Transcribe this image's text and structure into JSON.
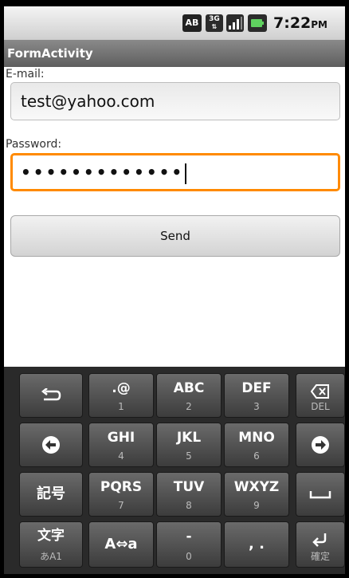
{
  "statusbar": {
    "ab_badge": "AB",
    "network_badge": "3G",
    "time": "7:22",
    "ampm": "PM"
  },
  "app": {
    "title": "FormActivity"
  },
  "form": {
    "email_label": "E-mail:",
    "email_value": "test@yahoo.com",
    "password_label": "Password:",
    "password_dots": "•••••••••••••",
    "send_label": "Send"
  },
  "keyboard": {
    "keys": {
      "undo": {
        "icon": "undo-arrow-icon"
      },
      "punct": {
        "main": ".@",
        "sub": "1"
      },
      "abc": {
        "main": "ABC",
        "sub": "2"
      },
      "def": {
        "main": "DEF",
        "sub": "3"
      },
      "del": {
        "icon": "delete-icon",
        "sub": "DEL"
      },
      "left": {
        "icon": "left-arrow-icon"
      },
      "ghi": {
        "main": "GHI",
        "sub": "4"
      },
      "jkl": {
        "main": "JKL",
        "sub": "5"
      },
      "mno": {
        "main": "MNO",
        "sub": "6"
      },
      "right": {
        "icon": "right-arrow-icon"
      },
      "symbols": {
        "main": "記号"
      },
      "pqrs": {
        "main": "PQRS",
        "sub": "7"
      },
      "tuv": {
        "main": "TUV",
        "sub": "8"
      },
      "wxyz": {
        "main": "WXYZ",
        "sub": "9"
      },
      "space": {
        "icon": "space-icon"
      },
      "mode": {
        "main": "文字",
        "sub": "あA1"
      },
      "case": {
        "main": "A⇔a"
      },
      "dash": {
        "main": "-",
        "sub": "0"
      },
      "comma": {
        "main": ", ."
      },
      "enter": {
        "icon": "enter-icon",
        "sub": "確定"
      }
    }
  },
  "colors": {
    "focus_border": "#ff8a00",
    "title_bar": "#6e6e6e",
    "keyboard_bg": "#2a2a2a"
  }
}
